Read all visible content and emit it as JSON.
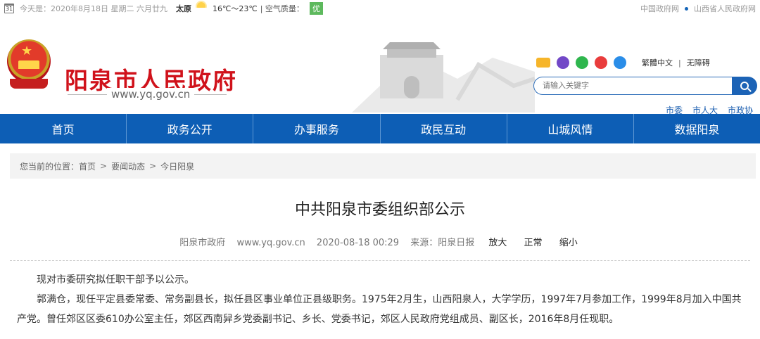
{
  "topbar": {
    "date": "今天是：2020年8月18日 星期二 六月廿九",
    "city": "太原",
    "temp": "16℃～23℃",
    "air_quality_label": "| 空气质量：",
    "air_quality_value": "优",
    "link_gov": "中国政府网",
    "link_province": "山西省人民政府网",
    "weather_icon": "sun-cloud-icon",
    "calendar_icon": "calendar-icon",
    "calendar_day": "31"
  },
  "header": {
    "site_title": "阳泉市人民政府",
    "site_url": "www.yq.gov.cn",
    "lang_traditional": "繁體中文",
    "lang_separator": "|",
    "accessibility": "无障碍",
    "search_placeholder": "请输入关键字",
    "org_links": [
      "市委",
      "市人大",
      "市政协"
    ],
    "share_icons": [
      "mail-icon",
      "mobile-icon",
      "wechat-icon",
      "weibo-icon",
      "app-icon"
    ],
    "accent_color": "#d0121b"
  },
  "nav": {
    "items": [
      "首页",
      "政务公开",
      "办事服务",
      "政民互动",
      "山城风情",
      "数据阳泉"
    ],
    "color": "#0d5eb5"
  },
  "breadcrumb": {
    "prefix": "您当前的位置：",
    "items": [
      "首页",
      "要闻动态",
      "今日阳泉"
    ],
    "separator": ">"
  },
  "article": {
    "title": "中共阳泉市委组织部公示",
    "source_site": "阳泉市政府",
    "url": "www.yq.gov.cn",
    "datetime": "2020-08-18 00:29",
    "source": "来源：阳泉日报",
    "font_large": "放大",
    "font_normal": "正常",
    "font_small": "缩小",
    "paragraphs": [
      "现对市委研究拟任职干部予以公示。",
      "郭满仓，现任平定县委常委、常务副县长，拟任县区事业单位正县级职务。1975年2月生，山西阳泉人，大学学历，1997年7月参加工作，1999年8月加入中国共产党。曾任郊区区委610办公室主任，郊区西南舁乡党委副书记、乡长、党委书记，郊区人民政府党组成员、副区长，2016年8月任现职。"
    ]
  }
}
